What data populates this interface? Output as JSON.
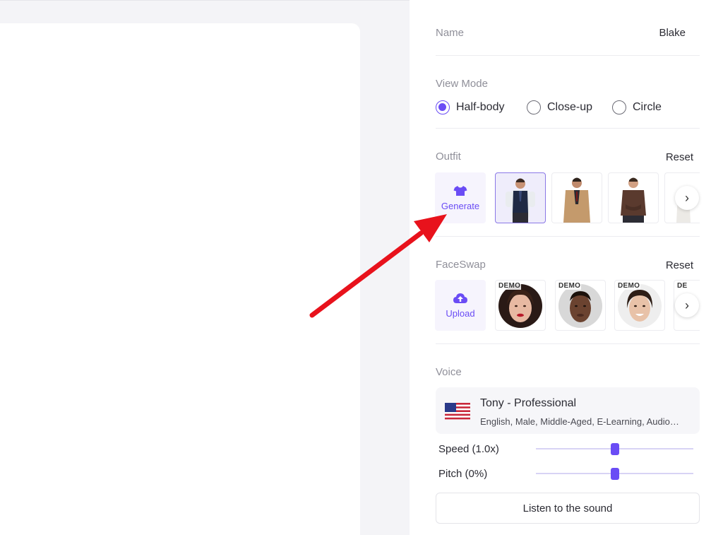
{
  "panel": {
    "name_label": "Name",
    "name_value": "Blake",
    "view_mode": {
      "label": "View Mode",
      "options": [
        "Half-body",
        "Close-up",
        "Circle"
      ],
      "selected": "Half-body"
    },
    "outfit": {
      "label": "Outfit",
      "reset": "Reset",
      "generate_label": "Generate",
      "icon": "tshirt-icon",
      "items": [
        "outfit-navy-vest",
        "outfit-camel-coat",
        "outfit-brown-sweater",
        "outfit-partial"
      ],
      "selected_index": 0
    },
    "faceswap": {
      "label": "FaceSwap",
      "reset": "Reset",
      "upload_label": "Upload",
      "icon": "cloud-upload-icon",
      "badge": "DEMO",
      "badge_partial": "DE"
    },
    "voice": {
      "label": "Voice",
      "flag": "us-flag-icon",
      "name": "Tony - Professional",
      "description": "English, Male, Middle-Aged, E-Learning, Audio…",
      "speed_label": "Speed (1.0x)",
      "speed_value": 0.5,
      "pitch_label": "Pitch (0%)",
      "pitch_value": 0.5,
      "listen_button": "Listen to the sound"
    }
  },
  "colors": {
    "accent": "#6a4cf5",
    "annotation_arrow": "#e8121c"
  }
}
